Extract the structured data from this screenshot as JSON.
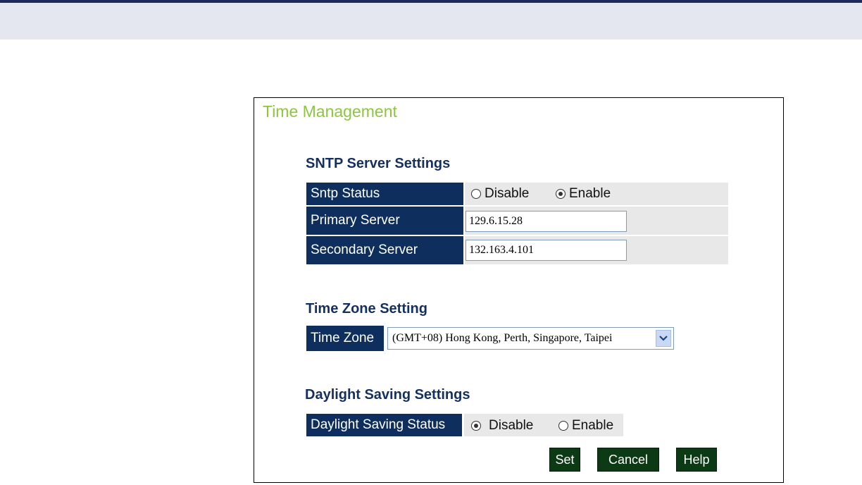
{
  "page": {
    "title": "Time Management"
  },
  "sntp": {
    "heading": "SNTP Server Settings",
    "status_label": "Sntp Status",
    "status_options": [
      "Disable",
      "Enable"
    ],
    "status_selected": "Enable",
    "primary_label": "Primary Server",
    "primary_value": "129.6.15.28",
    "secondary_label": "Secondary Server",
    "secondary_value": "132.163.4.101"
  },
  "timezone": {
    "heading": "Time Zone Setting",
    "label": "Time Zone",
    "selected": "(GMT+08) Hong Kong, Perth, Singapore, Taipei",
    "dropdown_icon": "chevron-down-icon"
  },
  "daylight": {
    "heading": "Daylight Saving Settings",
    "label": "Daylight Saving Status",
    "options": [
      "Disable",
      "Enable"
    ],
    "selected": "Disable"
  },
  "buttons": {
    "set": "Set",
    "cancel": "Cancel",
    "help": "Help"
  },
  "colors": {
    "title": "#8cc63f",
    "heading": "#14305e",
    "label_bg": "#0e2f5e",
    "value_bg": "#e8e8e8",
    "button_bg": "#0c3a14",
    "header_band": "#e4e7ef"
  }
}
